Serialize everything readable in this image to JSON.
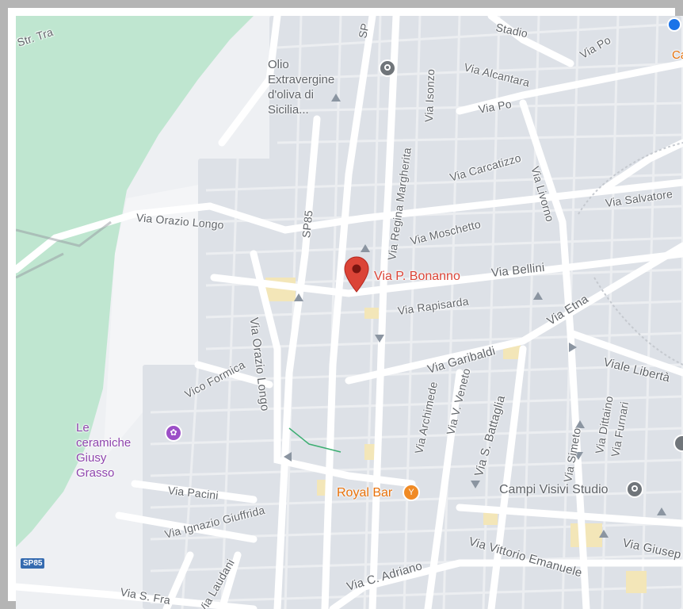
{
  "map": {
    "streets": [
      {
        "id": "str-tra",
        "label": "Str. Tra"
      },
      {
        "id": "stadio",
        "label": "Stadio"
      },
      {
        "id": "sp-top",
        "label": "SP"
      },
      {
        "id": "via-po-ne",
        "label": "Via Po"
      },
      {
        "id": "alcantara",
        "label": "Via Alcantara"
      },
      {
        "id": "isonzo",
        "label": "Via Isonzo"
      },
      {
        "id": "via-po",
        "label": "Via Po"
      },
      {
        "id": "carcatizzo",
        "label": "Via Carcatizzo"
      },
      {
        "id": "livorno",
        "label": "Via Livorno"
      },
      {
        "id": "salvatore",
        "label": "Via Salvatore"
      },
      {
        "id": "regina",
        "label": "Via Regina Margherita"
      },
      {
        "id": "moschetto",
        "label": "Via Moschetto"
      },
      {
        "id": "orazio-longo-h",
        "label": "Via Orazio Longo"
      },
      {
        "id": "sp85-v",
        "label": "SP85"
      },
      {
        "id": "bellini",
        "label": "Via Bellini"
      },
      {
        "id": "rapisarda",
        "label": "Via Rapisarda"
      },
      {
        "id": "etna",
        "label": "Via Etna"
      },
      {
        "id": "orazio-longo-v",
        "label": "Via Orazio Longo"
      },
      {
        "id": "garibaldi",
        "label": "Via Garibaldi"
      },
      {
        "id": "liberta",
        "label": "Viale Libertà"
      },
      {
        "id": "formica",
        "label": "Vico Formica"
      },
      {
        "id": "veneto",
        "label": "Via V. Veneto"
      },
      {
        "id": "archimede",
        "label": "Via Archimede"
      },
      {
        "id": "battaglia",
        "label": "Via S. Battaglia"
      },
      {
        "id": "dittaino",
        "label": "Via Dittaino"
      },
      {
        "id": "furnari",
        "label": "Via Furnari"
      },
      {
        "id": "simeto",
        "label": "Via Simeto"
      },
      {
        "id": "pacini",
        "label": "Via Pacini"
      },
      {
        "id": "giuffrida",
        "label": "Via Ignazio Giuffrida"
      },
      {
        "id": "vittorio",
        "label": "Via Vittorio Emanuele"
      },
      {
        "id": "giusep",
        "label": "Via Giusep"
      },
      {
        "id": "adriano",
        "label": "Via C. Adriano"
      },
      {
        "id": "laudani",
        "label": "Via Laudani"
      },
      {
        "id": "sfra",
        "label": "Via S. Fra"
      }
    ],
    "pins": {
      "selected": {
        "label": "Via P. Bonanno",
        "color": "#db4437"
      }
    },
    "pois": [
      {
        "id": "olio",
        "line1": "Olio Extravergine",
        "line2": "d'oliva di Sicilia...",
        "color": "#5f6368",
        "icon": "pin-gray-icon"
      },
      {
        "id": "ceramiche",
        "line1": "Le ceramiche",
        "line2": "Giusy Grasso",
        "color": "#8e44ad",
        "icon": "palette-icon"
      },
      {
        "id": "royal",
        "line1": "Royal Bar",
        "line2": "",
        "color": "#e8710a",
        "icon": "cocktail-icon"
      },
      {
        "id": "campi",
        "line1": "Campi Visivi Studio",
        "line2": "",
        "color": "#5f6368",
        "icon": "pin-gray-icon"
      }
    ],
    "badge": {
      "label": "SP85"
    },
    "edge_label": "Ca",
    "colors": {
      "park": "#bfe6d0",
      "road": "#ffffff",
      "block": "#dde1e7",
      "pin": "#db4437"
    }
  }
}
